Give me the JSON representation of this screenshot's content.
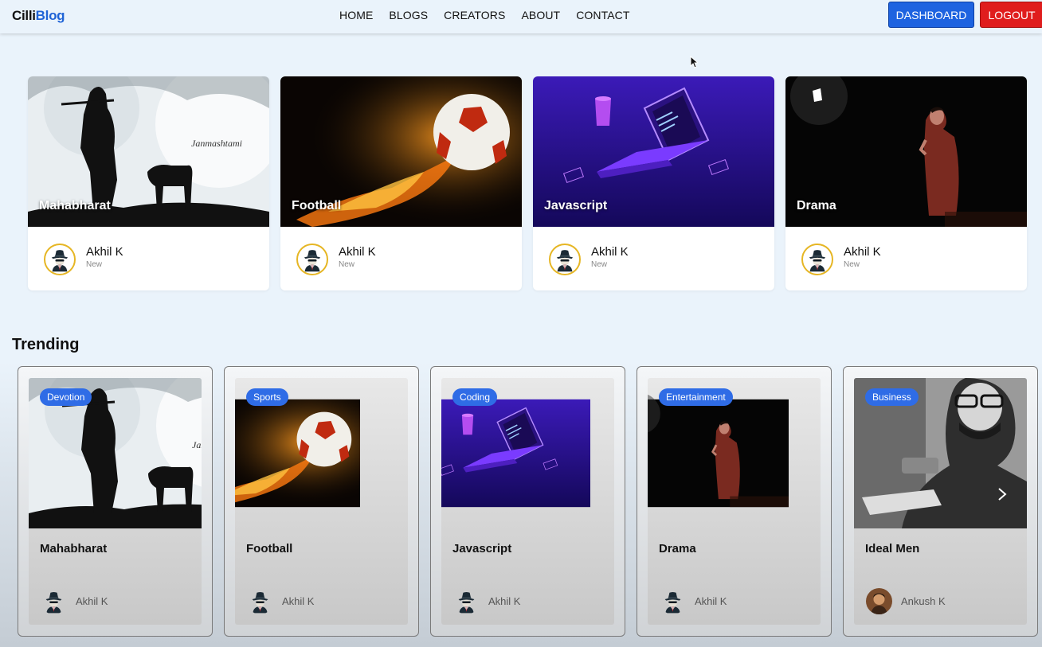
{
  "navbar": {
    "brand_part1": "Cilli",
    "brand_part2": "Blog",
    "links": [
      "HOME",
      "BLOGS",
      "CREATORS",
      "ABOUT",
      "CONTACT"
    ],
    "dashboard_label": "DASHBOARD",
    "logout_label": "LOGOUT"
  },
  "featured": [
    {
      "title": "Mahabharat",
      "author": "Akhil K",
      "status": "New",
      "image": "krishna-silhouette"
    },
    {
      "title": "Football",
      "author": "Akhil K",
      "status": "New",
      "image": "flaming-football"
    },
    {
      "title": "Javascript",
      "author": "Akhil K",
      "status": "New",
      "image": "isometric-laptop"
    },
    {
      "title": "Drama",
      "author": "Akhil K",
      "status": "New",
      "image": "stage-performer"
    }
  ],
  "trending": {
    "heading": "Trending",
    "cards": [
      {
        "category": "Devotion",
        "title": "Mahabharat",
        "author": "Akhil K"
      },
      {
        "category": "Sports",
        "title": "Football",
        "author": "Akhil K"
      },
      {
        "category": "Coding",
        "title": "Javascript",
        "author": "Akhil K"
      },
      {
        "category": "Entertainment",
        "title": "Drama",
        "author": "Akhil K"
      },
      {
        "category": "Business",
        "title": "Ideal Men",
        "author": "Ankush K"
      }
    ]
  },
  "colors": {
    "brand_blue": "#1f63d6",
    "dashboard": "#1e63e0",
    "logout": "#e01d1d",
    "badge": "#2f6ce6",
    "page_bg": "#eaf3fb"
  },
  "icons": {
    "spy_avatar": "spy-avatar-icon",
    "carousel_next": "chevron-right-icon"
  }
}
